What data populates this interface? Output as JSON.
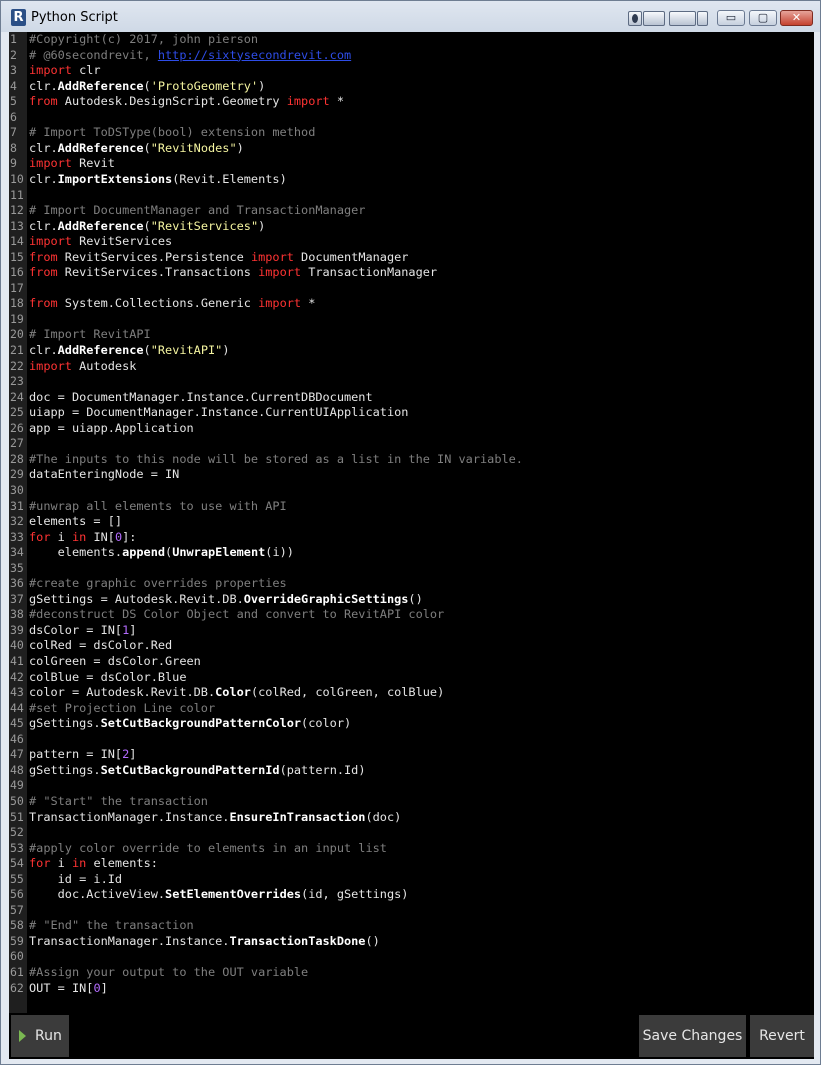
{
  "window": {
    "title": "Python Script",
    "app_icon_letter": "R",
    "controls": {
      "minimize": "▭",
      "maximize": "▢",
      "close": "✕"
    }
  },
  "editor": {
    "lines": [
      [
        [
          "c",
          "#Copyright(c) 2017, john pierson"
        ]
      ],
      [
        [
          "c",
          "# @60secondrevit, "
        ],
        [
          "u",
          "http://sixtysecondrevit.com"
        ]
      ],
      [
        [
          "k",
          "import"
        ],
        [
          "t",
          " clr"
        ]
      ],
      [
        [
          "t",
          "clr."
        ],
        [
          "f",
          "AddReference"
        ],
        [
          "t",
          "("
        ],
        [
          "s",
          "'ProtoGeometry'"
        ],
        [
          "t",
          ")"
        ]
      ],
      [
        [
          "k",
          "from"
        ],
        [
          "t",
          " Autodesk.DesignScript.Geometry "
        ],
        [
          "k",
          "import"
        ],
        [
          "t",
          " *"
        ]
      ],
      [],
      [
        [
          "c",
          "# Import ToDSType(bool) extension method"
        ]
      ],
      [
        [
          "t",
          "clr."
        ],
        [
          "f",
          "AddReference"
        ],
        [
          "t",
          "("
        ],
        [
          "s",
          "\"RevitNodes\""
        ],
        [
          "t",
          ")"
        ]
      ],
      [
        [
          "k",
          "import"
        ],
        [
          "t",
          " Revit"
        ]
      ],
      [
        [
          "t",
          "clr."
        ],
        [
          "f",
          "ImportExtensions"
        ],
        [
          "t",
          "(Revit.Elements)"
        ]
      ],
      [],
      [
        [
          "c",
          "# Import DocumentManager and TransactionManager"
        ]
      ],
      [
        [
          "t",
          "clr."
        ],
        [
          "f",
          "AddReference"
        ],
        [
          "t",
          "("
        ],
        [
          "s",
          "\"RevitServices\""
        ],
        [
          "t",
          ")"
        ]
      ],
      [
        [
          "k",
          "import"
        ],
        [
          "t",
          " RevitServices"
        ]
      ],
      [
        [
          "k",
          "from"
        ],
        [
          "t",
          " RevitServices.Persistence "
        ],
        [
          "k",
          "import"
        ],
        [
          "t",
          " DocumentManager"
        ]
      ],
      [
        [
          "k",
          "from"
        ],
        [
          "t",
          " RevitServices.Transactions "
        ],
        [
          "k",
          "import"
        ],
        [
          "t",
          " TransactionManager"
        ]
      ],
      [],
      [
        [
          "k",
          "from"
        ],
        [
          "t",
          " System.Collections.Generic "
        ],
        [
          "k",
          "import"
        ],
        [
          "t",
          " *"
        ]
      ],
      [],
      [
        [
          "c",
          "# Import RevitAPI"
        ]
      ],
      [
        [
          "t",
          "clr."
        ],
        [
          "f",
          "AddReference"
        ],
        [
          "t",
          "("
        ],
        [
          "s",
          "\"RevitAPI\""
        ],
        [
          "t",
          ")"
        ]
      ],
      [
        [
          "k",
          "import"
        ],
        [
          "t",
          " Autodesk"
        ]
      ],
      [],
      [
        [
          "t",
          "doc = DocumentManager.Instance.CurrentDBDocument"
        ]
      ],
      [
        [
          "t",
          "uiapp = DocumentManager.Instance.CurrentUIApplication"
        ]
      ],
      [
        [
          "t",
          "app = uiapp.Application"
        ]
      ],
      [],
      [
        [
          "c",
          "#The inputs to this node will be stored as a list in the IN variable."
        ]
      ],
      [
        [
          "t",
          "dataEnteringNode = IN"
        ]
      ],
      [],
      [
        [
          "c",
          "#unwrap all elements to use with API"
        ]
      ],
      [
        [
          "t",
          "elements = []"
        ]
      ],
      [
        [
          "k",
          "for"
        ],
        [
          "t",
          " i "
        ],
        [
          "k",
          "in"
        ],
        [
          "t",
          " IN["
        ],
        [
          "n",
          "0"
        ],
        [
          "t",
          "]:"
        ]
      ],
      [
        [
          "t",
          "    elements."
        ],
        [
          "f",
          "append"
        ],
        [
          "t",
          "("
        ],
        [
          "f",
          "UnwrapElement"
        ],
        [
          "t",
          "(i))"
        ]
      ],
      [],
      [
        [
          "c",
          "#create graphic overrides properties"
        ]
      ],
      [
        [
          "t",
          "gSettings = Autodesk.Revit.DB."
        ],
        [
          "f",
          "OverrideGraphicSettings"
        ],
        [
          "t",
          "()"
        ]
      ],
      [
        [
          "c",
          "#deconstruct DS Color Object and convert to RevitAPI color"
        ]
      ],
      [
        [
          "t",
          "dsColor = IN["
        ],
        [
          "n",
          "1"
        ],
        [
          "t",
          "]"
        ]
      ],
      [
        [
          "t",
          "colRed = dsColor.Red"
        ]
      ],
      [
        [
          "t",
          "colGreen = dsColor.Green"
        ]
      ],
      [
        [
          "t",
          "colBlue = dsColor.Blue"
        ]
      ],
      [
        [
          "t",
          "color = Autodesk.Revit.DB."
        ],
        [
          "f",
          "Color"
        ],
        [
          "t",
          "(colRed, colGreen, colBlue)"
        ]
      ],
      [
        [
          "c",
          "#set Projection Line color"
        ]
      ],
      [
        [
          "t",
          "gSettings."
        ],
        [
          "f",
          "SetCutBackgroundPatternColor"
        ],
        [
          "t",
          "(color)"
        ]
      ],
      [],
      [
        [
          "t",
          "pattern = IN["
        ],
        [
          "n",
          "2"
        ],
        [
          "t",
          "]"
        ]
      ],
      [
        [
          "t",
          "gSettings."
        ],
        [
          "f",
          "SetCutBackgroundPatternId"
        ],
        [
          "t",
          "(pattern.Id)"
        ]
      ],
      [],
      [
        [
          "c",
          "# \"Start\" the transaction"
        ]
      ],
      [
        [
          "t",
          "TransactionManager.Instance."
        ],
        [
          "f",
          "EnsureInTransaction"
        ],
        [
          "t",
          "(doc)"
        ]
      ],
      [],
      [
        [
          "c",
          "#apply color override to elements in an input list"
        ]
      ],
      [
        [
          "k",
          "for"
        ],
        [
          "t",
          " i "
        ],
        [
          "k",
          "in"
        ],
        [
          "t",
          " elements:"
        ]
      ],
      [
        [
          "t",
          "    id = i.Id"
        ]
      ],
      [
        [
          "t",
          "    doc.ActiveView."
        ],
        [
          "f",
          "SetElementOverrides"
        ],
        [
          "t",
          "(id, gSettings)"
        ]
      ],
      [],
      [
        [
          "c",
          "# \"End\" the transaction"
        ]
      ],
      [
        [
          "t",
          "TransactionManager.Instance."
        ],
        [
          "f",
          "TransactionTaskDone"
        ],
        [
          "t",
          "()"
        ]
      ],
      [],
      [
        [
          "c",
          "#Assign your output to the OUT variable"
        ]
      ],
      [
        [
          "t",
          "OUT = IN["
        ],
        [
          "n",
          "0"
        ],
        [
          "t",
          "]"
        ]
      ]
    ]
  },
  "actions": {
    "run_label": "Run",
    "save_label": "Save Changes",
    "revert_label": "Revert"
  },
  "colors": {
    "editor_bg": "#000000",
    "comment": "#7f7f7f",
    "keyword": "#ff3333",
    "string": "#f5f5a0",
    "number": "#b46cff",
    "link": "#2e4de8",
    "run_icon": "#7ab852"
  }
}
